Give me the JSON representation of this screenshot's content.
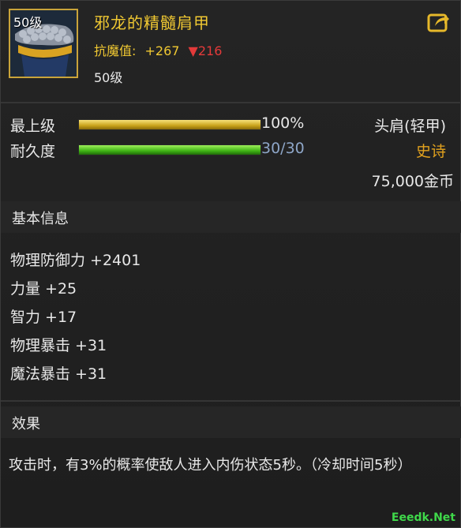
{
  "item": {
    "icon_level": "50级",
    "name": "邪龙的精髓肩甲",
    "stat_label": "抗魔值:",
    "stat_value": "+267",
    "stat_change": "▼216",
    "level": "50级"
  },
  "bars": {
    "upgrade_label": "最上级",
    "upgrade_value": "100%",
    "upgrade_fill": 1.0,
    "durability_label": "耐久度",
    "durability_value": "30/30",
    "durability_fill": 1.0
  },
  "meta": {
    "slot": "头肩(轻甲)",
    "rarity": "史诗",
    "price": "75,000金币"
  },
  "basic": {
    "title": "基本信息",
    "attrs": [
      "物理防御力 +2401",
      "力量 +25",
      "智力 +17",
      "物理暴击 +31",
      "魔法暴击 +31"
    ]
  },
  "effect": {
    "title": "效果",
    "text": "攻击时，有3%的概率使敌人进入内伤状态5秒。（冷却时间5秒）"
  },
  "watermark": "Eeedk.Net",
  "colors": {
    "title_gold": "#f0c832",
    "rarity_orange": "#e2a21e",
    "down_red": "#e33a3a",
    "bar_gold": "#d8b02a",
    "bar_green": "#4cc21c",
    "durability_text": "#8ea6c8"
  }
}
